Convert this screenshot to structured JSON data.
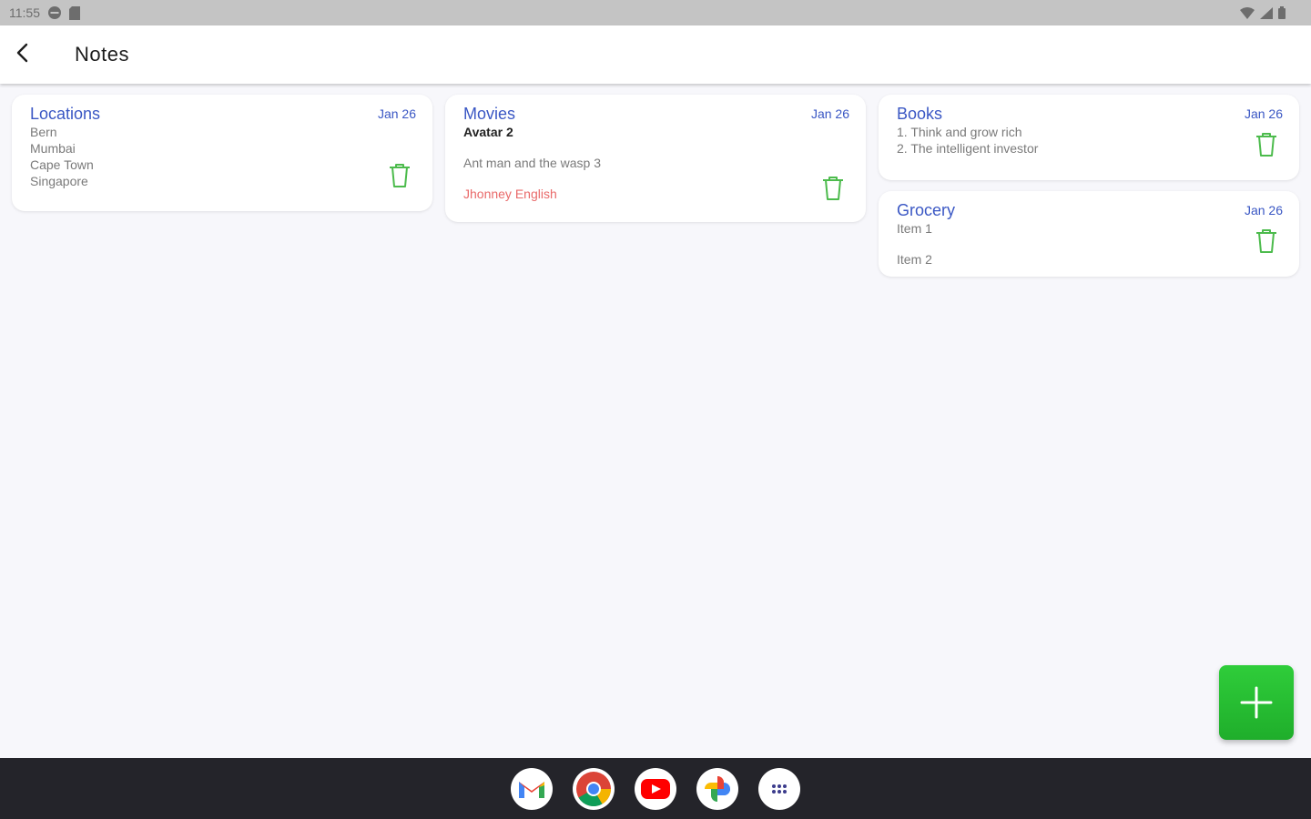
{
  "status_bar": {
    "time": "11:55",
    "icons": [
      "do-not-disturb-icon",
      "sim-card-icon",
      "wifi-icon",
      "cell-signal-icon",
      "battery-icon"
    ]
  },
  "app_bar": {
    "title": "Notes",
    "back_icon": "arrow-back-icon"
  },
  "notes": [
    {
      "title": "Locations",
      "date": "Jan 26",
      "lines": [
        "Bern",
        "Mumbai",
        "Cape Town",
        "Singapore"
      ]
    },
    {
      "title": "Movies",
      "date": "Jan 26",
      "lines": [
        "Avatar 2",
        "Ant man and the wasp 3",
        "Jhonney English"
      ]
    },
    {
      "title": "Books",
      "date": "Jan 26",
      "lines": [
        "1. Think and grow rich",
        "2. The intelligent investor"
      ]
    },
    {
      "title": "Grocery",
      "date": "Jan 26",
      "lines": [
        "Item 1",
        "Item 2"
      ]
    }
  ],
  "colors": {
    "note_title": "#3a57c4",
    "trash_icon": "#4cbb4c",
    "accent_red": "#e96a6a",
    "fab": "#2fcd3a",
    "taskbar": "#24242a"
  },
  "fab": {
    "icon": "plus-icon"
  },
  "taskbar": {
    "apps": [
      "gmail-icon",
      "chrome-icon",
      "youtube-icon",
      "photos-icon",
      "app-drawer-icon"
    ]
  }
}
